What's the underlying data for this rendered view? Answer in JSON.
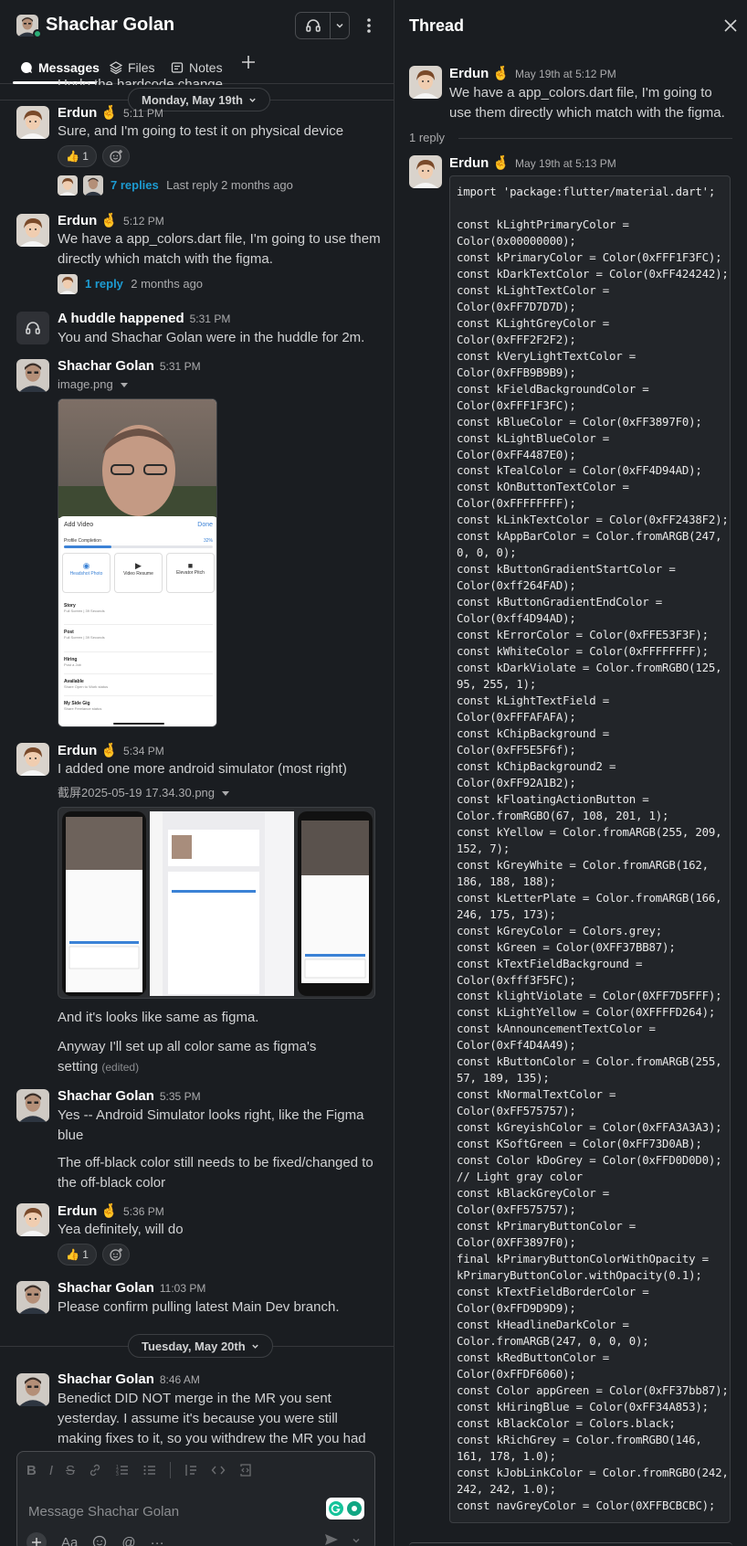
{
  "channel": {
    "title": "Shachar Golan"
  },
  "tabs": [
    {
      "label": "Messages"
    },
    {
      "label": "Files"
    },
    {
      "label": "Notes"
    }
  ],
  "dates": {
    "monday": "Monday, May 19th",
    "tuesday": "Tuesday, May 20th"
  },
  "messages": {
    "m0_partial": "Undo the hardcode change",
    "m1": {
      "author": "Erdun",
      "author_emoji": "🤞",
      "time": "5:11 PM",
      "text": "Sure, and I'm going to test it on physical device",
      "reaction": "👍 1",
      "replies": "7 replies",
      "last_reply": "Last reply 2 months ago"
    },
    "m2": {
      "author": "Erdun",
      "author_emoji": "🤞",
      "time": "5:12 PM",
      "text": "We have a app_colors.dart file, I'm going to use them directly which match with the figma.",
      "replies": "1 reply",
      "last_reply": "2 months ago"
    },
    "m3": {
      "author": "A huddle happened",
      "time": "5:31 PM",
      "text": "You and Shachar Golan were in the huddle for 2m."
    },
    "m4": {
      "author": "Shachar Golan",
      "time": "5:31 PM",
      "file": "image.png"
    },
    "m5": {
      "author": "Erdun",
      "author_emoji": "🤞",
      "time": "5:34 PM",
      "text": "I added one more android simulator (most right)",
      "file": "截屏2025-05-19 17.34.30.png"
    },
    "m5b": "And it's looks like same as figma.",
    "m5c": "Anyway I'll set up all color same as figma's setting",
    "m5c_edited": "(edited)",
    "m6": {
      "author": "Shachar Golan",
      "time": "5:35 PM",
      "text": "Yes -- Android Simulator looks right, like the Figma blue"
    },
    "m6b": "The off-black color still needs to be fixed/changed to the off-black color",
    "m7": {
      "author": "Erdun",
      "author_emoji": "🤞",
      "time": "5:36 PM",
      "text": "Yea definitely, will do",
      "reaction": "👍 1"
    },
    "m8": {
      "author": "Shachar Golan",
      "time": "11:03 PM",
      "text": "Please confirm pulling latest Main Dev branch."
    },
    "m9": {
      "author": "Shachar Golan",
      "time": "8:46 AM",
      "text": "Benedict DID NOT merge in the MR you sent yesterday. I assume it's because you were still making fixes to it, so you withdrew the MR you had"
    }
  },
  "phone_mock": {
    "sheet_title": "Add Video",
    "done": "Done",
    "profile_completion": "Profile Completion",
    "percent": "32%",
    "progress": 0.32,
    "tiles": [
      "Headshot Photo",
      "Video Resume",
      "Elevator Pitch"
    ],
    "rows": [
      {
        "title": "Story",
        "sub": "Full Screen | 39 Seconds"
      },
      {
        "title": "Post",
        "sub": "Full Screen | 39 Seconds"
      },
      {
        "title": "Hiring",
        "sub": "Post a Job"
      },
      {
        "title": "Available",
        "sub": "Share Open to Work status"
      },
      {
        "title": "My Side Gig",
        "sub": "Share Freelance status"
      }
    ]
  },
  "composer": {
    "placeholder": "Message Shachar Golan"
  },
  "thread": {
    "title": "Thread",
    "parent": {
      "author": "Erdun",
      "author_emoji": "🤞",
      "time": "May 19th at 5:12 PM",
      "text": "We have a app_colors.dart file, I'm going to use them directly which match with the figma."
    },
    "reply_count": "1 reply",
    "reply": {
      "author": "Erdun",
      "author_emoji": "🤞",
      "time": "May 19th at 5:13 PM"
    },
    "code_lines": [
      "import 'package:flutter/material.dart';",
      "",
      "const kLightPrimaryColor =",
      "Color(0x00000000);",
      "const kPrimaryColor = Color(0xFFF1F3FC);",
      "const kDarkTextColor = Color(0xFF424242);",
      "const kLightTextColor =",
      "Color(0xFF7D7D7D);",
      "const KLightGreyColor =",
      "Color(0xFFF2F2F2);",
      "const kVeryLightTextColor =",
      "Color(0xFFB9B9B9);",
      "const kFieldBackgroundColor =",
      "Color(0xFFF1F3FC);",
      "const kBlueColor = Color(0xFF3897F0);",
      "const kLightBlueColor =",
      "Color(0xFF4487E0);",
      "const kTealColor = Color(0xFF4D94AD);",
      "const kOnButtonTextColor =",
      "Color(0xFFFFFFFF);",
      "const kLinkTextColor = Color(0xFF2438F2);",
      "const kAppBarColor = Color.fromARGB(247,",
      "0, 0, 0);",
      "const kButtonGradientStartColor =",
      "Color(0xff264FAD);",
      "const kButtonGradientEndColor =",
      "Color(0xff4D94AD);",
      "const kErrorColor = Color(0xFFE53F3F);",
      "const kWhiteColor = Color(0xFFFFFFFF);",
      "const kDarkViolate = Color.fromRGBO(125,",
      "95, 255, 1);",
      "const kLightTextField =",
      "Color(0xFFFAFAFA);",
      "const kChipBackground =",
      "Color(0xFF5E5F6f);",
      "const kChipBackground2 =",
      "Color(0xFF92A1B2);",
      "const kFloatingActionButton =",
      "Color.fromRGBO(67, 108, 201, 1);",
      "const kYellow = Color.fromARGB(255, 209,",
      "152, 7);",
      "const kGreyWhite = Color.fromARGB(162,",
      "186, 188, 188);",
      "const kLetterPlate = Color.fromARGB(166,",
      "246, 175, 173);",
      "const kGreyColor = Colors.grey;",
      "const kGreen = Color(0XFF37BB87);",
      "const kTextFieldBackground =",
      "Color(0xfff3F5FC);",
      "const klightViolate = Color(0XFF7D5FFF);",
      "const kLightYellow = Color(0XFFFFD264);",
      "const kAnnouncementTextColor =",
      "Color(0xFf4D4A49);",
      "const kButtonColor = Color.fromARGB(255,",
      "57, 189, 135);",
      "const kNormalTextColor =",
      "Color(0xFF575757);",
      "const kGreyishColor = Color(0xFFA3A3A3);",
      "const KSoftGreen = Color(0xFF73D0AB);",
      "const Color kDoGrey = Color(0xFFD0D0D0);",
      "// Light gray color",
      "const kBlackGreyColor =",
      "Color(0xFF575757);",
      "const kPrimaryButtonColor =",
      "Color(0XFF3897F0);",
      "final kPrimaryButtonColorWithOpacity =",
      "kPrimaryButtonColor.withOpacity(0.1);",
      "const kTextFieldBorderColor =",
      "Color(0xFFD9D9D9);",
      "const kHeadlineDarkColor =",
      "Color.fromARGB(247, 0, 0, 0);",
      "const kRedButtonColor =",
      "Color(0xFFDF6060);",
      "const Color appGreen = Color(0xFF37bb87);",
      "const kHiringBlue = Color(0xFF34A853);",
      "const kBlackColor = Colors.black;",
      "const kRichGrey = Color.fromRGBO(146,",
      "161, 178, 1.0);",
      "const kJobLinkColor = Color.fromRGBO(242,",
      "242, 242, 1.0);",
      "const navGreyColor = Color(0XFFBCBCBC);"
    ]
  },
  "colors": {
    "background": "#1a1d21",
    "link": "#1d9bd1",
    "presence": "#2bac76",
    "phone_accent": "#3b82d6"
  }
}
